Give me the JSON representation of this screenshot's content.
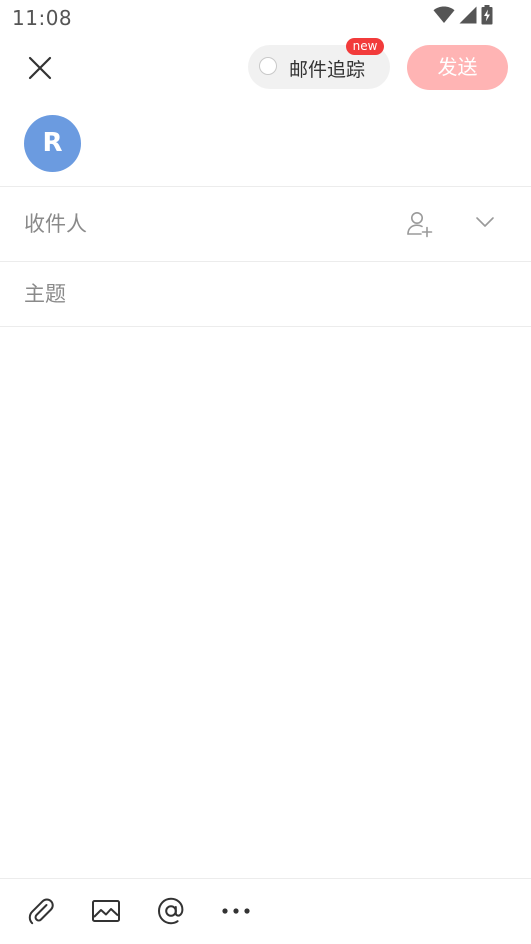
{
  "status_bar": {
    "time": "11:08",
    "icons": [
      "wifi-icon",
      "cellular-signal-icon",
      "battery-charging-icon"
    ]
  },
  "top_bar": {
    "close_icon": "close-icon",
    "tracking": {
      "label": "邮件追踪",
      "badge": "new",
      "enabled": false
    },
    "send_label": "发送",
    "send_color": "#ffb4b4"
  },
  "sender": {
    "avatar_initial": "R",
    "avatar_color": "#6b9be0"
  },
  "recipients": {
    "label": "收件人",
    "add_icon": "add-contact-icon",
    "expand_icon": "chevron-down-icon"
  },
  "subject": {
    "value": "",
    "placeholder": "主题"
  },
  "body": {
    "value": ""
  },
  "toolbar": {
    "items": [
      "attachment-icon",
      "image-icon",
      "mention-icon",
      "more-icon"
    ]
  },
  "colors": {
    "accent": "#f23b3b",
    "muted_text": "#8a8a8a"
  }
}
